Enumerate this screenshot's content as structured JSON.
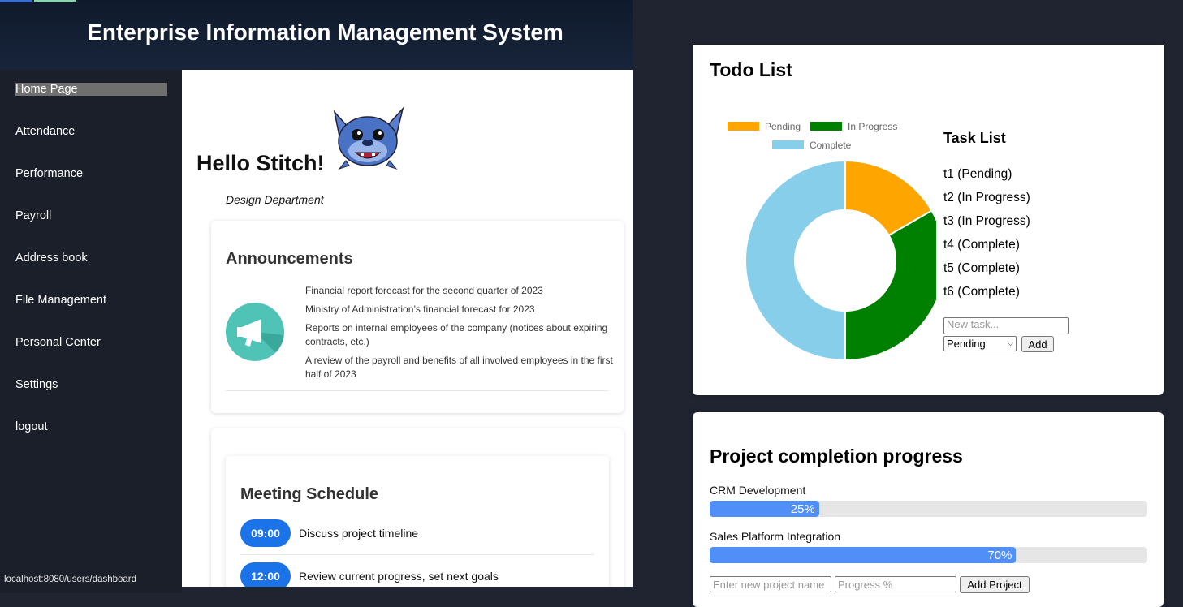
{
  "app": {
    "title": "Enterprise Information Management System",
    "status_url": "localhost:8080/users/dashboard"
  },
  "sidebar": {
    "items": [
      {
        "label": "Home Page",
        "active": true
      },
      {
        "label": "Attendance"
      },
      {
        "label": "Performance"
      },
      {
        "label": "Payroll"
      },
      {
        "label": "Address book"
      },
      {
        "label": "File Management"
      },
      {
        "label": "Personal Center"
      },
      {
        "label": "Settings"
      },
      {
        "label": "logout"
      }
    ]
  },
  "profile": {
    "greeting": "Hello Stitch!",
    "department": "Design Department",
    "avatar_icon": "stitch-avatar-icon"
  },
  "announcements": {
    "title": "Announcements",
    "icon": "megaphone-icon",
    "items": [
      "Financial report forecast for the second quarter of 2023",
      "Ministry of Administration’s financial forecast for 2023",
      "Reports on internal employees of the company (notices about expiring contracts, etc.)",
      "A review of the payroll and benefits of all involved employees in the first half of 2023"
    ]
  },
  "meetings": {
    "title": "Meeting Schedule",
    "items": [
      {
        "time": "09:00",
        "text": "Discuss project timeline"
      },
      {
        "time": "12:00",
        "text": "Review current progress, set next goals"
      }
    ]
  },
  "todo": {
    "title": "Todo List",
    "task_list_title": "Task List",
    "tasks": [
      "t1 (Pending)",
      "t2 (In Progress)",
      "t3 (In Progress)",
      "t4 (Complete)",
      "t5 (Complete)",
      "t6 (Complete)"
    ],
    "new_task_placeholder": "New task...",
    "status_selected": "Pending",
    "add_label": "Add"
  },
  "chart_data": {
    "type": "pie",
    "categories": [
      "Pending",
      "In Progress",
      "Complete"
    ],
    "values": [
      1,
      2,
      3
    ],
    "colors": [
      "#ffa500",
      "#008000",
      "#87ceeb"
    ],
    "legend": "top",
    "donut": true
  },
  "projects": {
    "title": "Project completion progress",
    "items": [
      {
        "name": "CRM Development",
        "progress": 25,
        "label": "25%"
      },
      {
        "name": "Sales Platform Integration",
        "progress": 70,
        "label": "70%"
      }
    ],
    "name_placeholder": "Enter new project name",
    "progress_placeholder": "Progress %",
    "add_label": "Add Project"
  }
}
